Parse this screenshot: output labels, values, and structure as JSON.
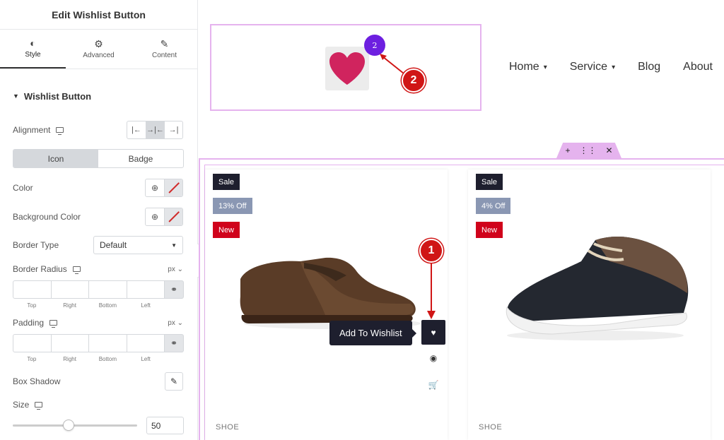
{
  "panel": {
    "title": "Edit Wishlist Button",
    "tabs": [
      {
        "label": "Style",
        "icon": "half-circle-icon"
      },
      {
        "label": "Advanced",
        "icon": "gear-icon"
      },
      {
        "label": "Content",
        "icon": "pencil-icon"
      }
    ],
    "section_title": "Wishlist Button",
    "alignment_label": "Alignment",
    "display_toggle": {
      "icon_label": "Icon",
      "badge_label": "Badge",
      "selected": "Icon"
    },
    "color_label": "Color",
    "bg_color_label": "Background Color",
    "border_type_label": "Border Type",
    "border_type_value": "Default",
    "border_radius_label": "Border Radius",
    "unit_label": "px",
    "padding_label": "Padding",
    "dimension_labels": [
      "Top",
      "Right",
      "Bottom",
      "Left"
    ],
    "box_shadow_label": "Box Shadow",
    "size_label": "Size",
    "size_value": "50",
    "size_fraction": 0.45
  },
  "header": {
    "wishlist_count": "2",
    "nav": [
      {
        "label": "Home",
        "has_dropdown": true
      },
      {
        "label": "Service",
        "has_dropdown": true
      },
      {
        "label": "Blog",
        "has_dropdown": false
      },
      {
        "label": "About",
        "has_dropdown": false
      }
    ]
  },
  "products": [
    {
      "sale": "Sale",
      "discount": "13% Off",
      "new": "New",
      "category": "SHOE",
      "tooltip": "Add To Wishlist",
      "image": "brown-oxford-shoe"
    },
    {
      "sale": "Sale",
      "discount": "4% Off",
      "new": "New",
      "category": "SHOE",
      "image": "black-sneaker-shoe"
    }
  ],
  "callouts": [
    "1",
    "2"
  ],
  "colors": {
    "accent_pink": "#e5b3ee",
    "badge_purple": "#6d1fe0",
    "callout_red": "#d01616",
    "heart": "#d0245e",
    "dark": "#1e1f2e"
  }
}
